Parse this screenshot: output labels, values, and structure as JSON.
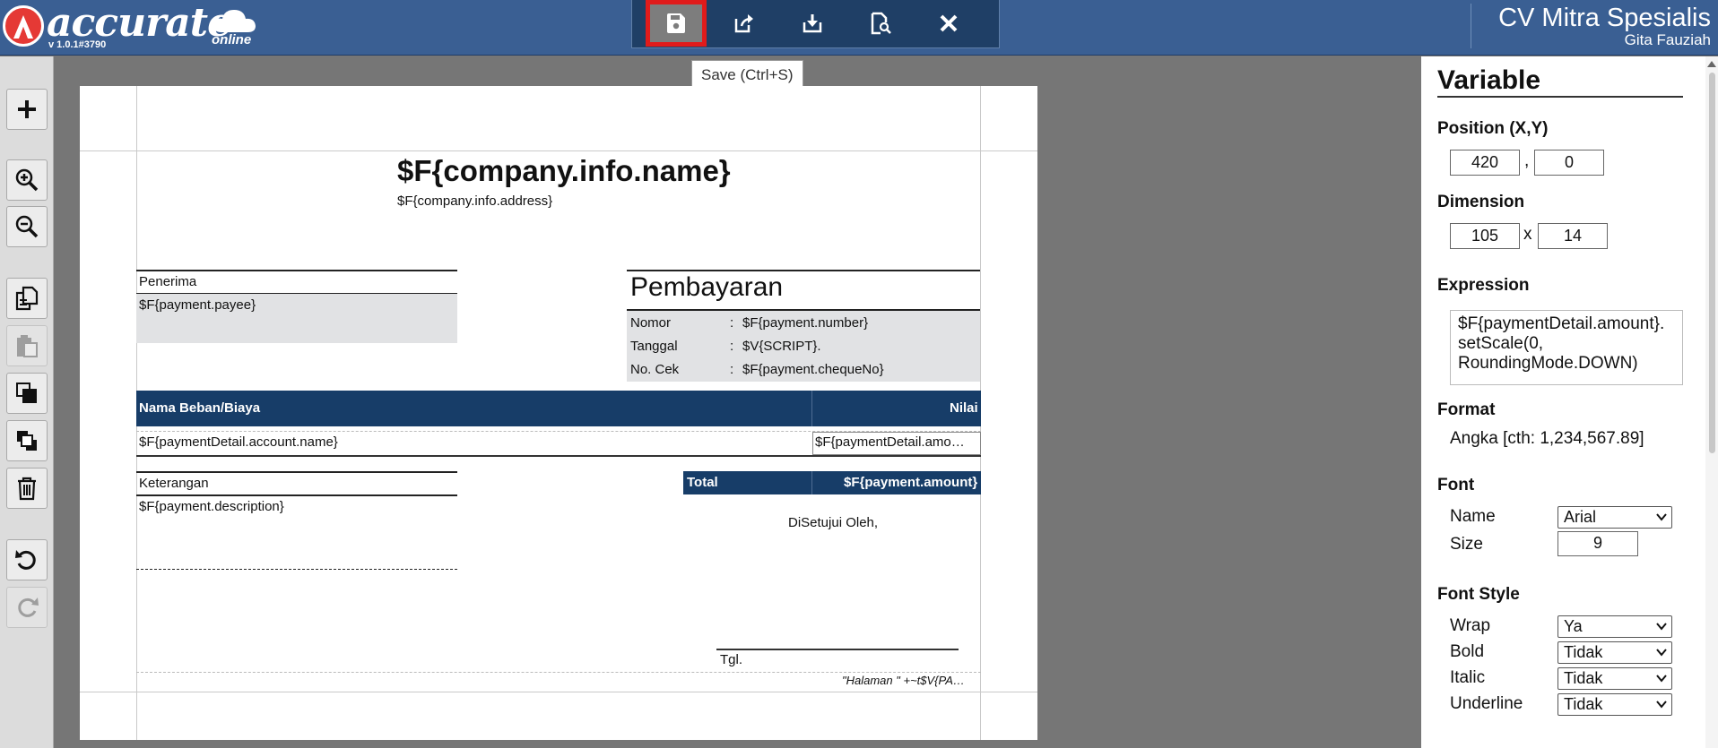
{
  "header": {
    "brand": "accurate",
    "brand_suffix": "online",
    "version": "v 1.0.1#3790",
    "company_name": "CV Mitra Spesialis",
    "user_name": "Gita Fauziah",
    "colors": {
      "header_bg": "#3a5f93",
      "toolbar_bg": "#1f3f66",
      "highlight": "#e01b1b",
      "navy": "#173d68"
    }
  },
  "toolbar": {
    "buttons": [
      {
        "icon": "save-icon"
      },
      {
        "icon": "export-icon"
      },
      {
        "icon": "import-icon"
      },
      {
        "icon": "preview-icon"
      },
      {
        "icon": "close-icon"
      }
    ],
    "tooltip": "Save (Ctrl+S)"
  },
  "sidebar": {
    "buttons": [
      {
        "icon": "plus-icon"
      },
      {
        "icon": "zoom-in-icon"
      },
      {
        "icon": "zoom-out-icon"
      },
      {
        "icon": "copy-icon"
      },
      {
        "icon": "paste-icon"
      },
      {
        "icon": "bring-front-icon"
      },
      {
        "icon": "send-back-icon"
      },
      {
        "icon": "trash-icon"
      },
      {
        "icon": "undo-icon"
      },
      {
        "icon": "redo-icon"
      }
    ]
  },
  "report": {
    "company_name": "$F{company.info.name}",
    "company_address": "$F{company.info.address}",
    "payee_label": "Penerima",
    "payee_value": "$F{payment.payee}",
    "title": "Pembayaran",
    "info_rows": [
      {
        "label": "Nomor",
        "sep": ":",
        "value": "$F{payment.number}"
      },
      {
        "label": "Tanggal",
        "sep": ":",
        "value": "$V{SCRIPT}."
      },
      {
        "label": "No. Cek",
        "sep": ":",
        "value": "$F{payment.chequeNo}"
      }
    ],
    "table_header_name": "Nama Beban/Biaya",
    "table_header_value": "Nilai",
    "row_name": "$F{paymentDetail.account.name}",
    "row_value": "$F{paymentDetail.amo…",
    "notes_label": "Keterangan",
    "notes_value": "$F{payment.description}",
    "total_label": "Total",
    "total_value": "$F{payment.amount}",
    "approved_by": "DiSetujui Oleh,",
    "date_label": "Tgl.",
    "page_footer": "\"Halaman \" +~t$V{PA…"
  },
  "panel": {
    "title": "Variable",
    "position_label": "Position (X,Y)",
    "position_x": "420",
    "position_sep": ",",
    "position_y": "0",
    "dimension_label": "Dimension",
    "dimension_w": "105",
    "dimension_sep": "x",
    "dimension_h": "14",
    "expression_label": "Expression",
    "expression_lines": [
      "$F{paymentDetail.amount}.",
      "setScale(0,",
      "RoundingMode.DOWN)"
    ],
    "format_label": "Format",
    "format_value": "Angka [cth: 1,234,567.89]",
    "font_label": "Font",
    "font_name_label": "Name",
    "font_name_value": "Arial",
    "font_size_label": "Size",
    "font_size_value": "9",
    "font_style_label": "Font Style",
    "wrap_label": "Wrap",
    "wrap_value": "Ya",
    "bold_label": "Bold",
    "bold_value": "Tidak",
    "italic_label": "Italic",
    "italic_value": "Tidak",
    "underline_label": "Underline",
    "underline_value": "Tidak"
  }
}
